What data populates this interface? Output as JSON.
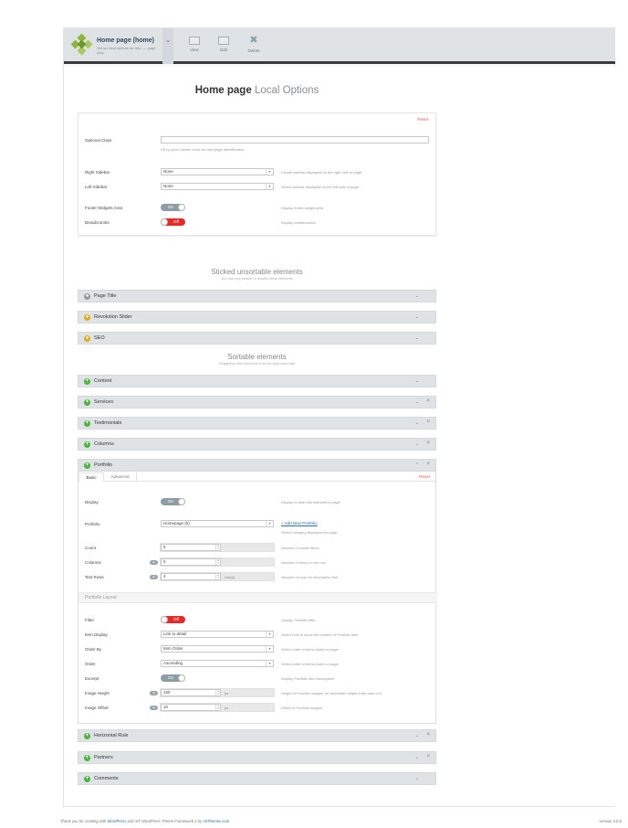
{
  "header": {
    "page_title": "Home page (home)",
    "page_subtitle": "Set up local options for this ---- page only",
    "actions": {
      "view": "View",
      "edit": "Edit",
      "delete": "Delete"
    }
  },
  "local": {
    "heading_main": "Home page",
    "heading_sub": "Local Options",
    "reset": "Reset",
    "optional_class_label": "Optional Class",
    "optional_class_help": "Fill by your custom class for own page identification",
    "right_sidebar_label": "Right Sidebar",
    "right_sidebar_value": "None",
    "right_sidebar_help": "Create sidebar displayed on the right side of page",
    "left_sidebar_label": "Left Sidebar",
    "left_sidebar_value": "None",
    "left_sidebar_help": "Select sidebar displayed on the left side of page",
    "footer_widgets_label": "Footer Widgets Area",
    "footer_widgets_state": "On",
    "footer_widgets_help": "Display footer widget area",
    "breadcrumbs_label": "Breadcrumbs",
    "breadcrumbs_state": "Off",
    "breadcrumbs_help": "Display breadcrumbs"
  },
  "sticked": {
    "title": "Sticked unsortable elements",
    "subtitle": "You can only enable or disable these elements",
    "items": [
      "Page Title",
      "Revolution Slider",
      "SEO"
    ]
  },
  "sortable": {
    "title": "Sortable elements",
    "subtitle": "Drag&drop new elements from the right hand side",
    "items": [
      "Content",
      "Services",
      "Testimonials",
      "Columns",
      "Portfolio"
    ],
    "bottom_items": [
      "Horizontal Rule",
      "Partners",
      "Comments"
    ]
  },
  "portfolio": {
    "tab_basic": "Basic",
    "tab_advanced": "Advanced",
    "reset": "Reset",
    "display_label": "Display",
    "display_state": "On",
    "display_help": "Display or hide this element on page",
    "portfolio_label": "Portfolio",
    "portfolio_value": "Homepage (5)",
    "add_new": "+ Add New Portfolio",
    "portfolio_help": "Select category displayed on page",
    "count_label": "Count",
    "count_value": "5",
    "count_help": "Number of visible items",
    "columns_label": "Columns",
    "columns_value": "5",
    "columns_help": "Number of items in one row",
    "text_rows_label": "Text Rows",
    "text_rows_value": "4",
    "text_rows_unit": "row(s)",
    "text_rows_help": "Number of rows for description text",
    "layout_title": "Portfolio Layout",
    "filter_label": "Filter",
    "filter_state": "Off",
    "filter_help": "Display Portfolio filter",
    "item_display_label": "Item Display",
    "item_display_value": "Link to detail",
    "item_display_help": "Select how to show the content of Portfolio item",
    "order_by_label": "Order By",
    "order_by_value": "Item Order",
    "order_by_help": "Select order of items listed on page",
    "order_label": "Order",
    "order_value": "Ascending",
    "order_help": "Select order of items listed on page",
    "excerpt_label": "Excerpt",
    "excerpt_state": "On",
    "excerpt_help": "Display Portfolio item description",
    "image_height_label": "Image Height",
    "image_height_value": "150",
    "image_height_unit": "px",
    "image_height_help": "Height of Portfolio images, for automatic height enter auto or 0",
    "image_offset_label": "Image Offset",
    "image_offset_value": "10",
    "image_offset_unit": "px",
    "image_offset_help": "Offset of Portfolio images",
    "mini_on": "on"
  },
  "footer": {
    "text_before": "Thank you for creating with ",
    "wp": "WordPress",
    "text_mid": " and AIT WordPress Theme Framework 2 by ",
    "ait": "AitThemes.com",
    "version": "Version 2.8.5"
  },
  "colors": {
    "accent_green": "#4fb43f",
    "toggle_off": "#e22a2a",
    "sticked_orange": "#e6a817"
  }
}
